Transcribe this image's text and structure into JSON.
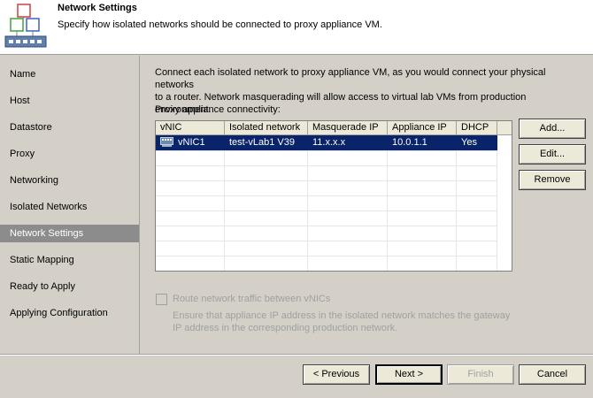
{
  "header": {
    "title": "Network Settings",
    "subtitle": "Specify how isolated networks should be connected to proxy appliance VM.",
    "logo_icon": "network-wizard-icon"
  },
  "sidebar": {
    "items": [
      {
        "label": "Name"
      },
      {
        "label": "Host"
      },
      {
        "label": "Datastore"
      },
      {
        "label": "Proxy"
      },
      {
        "label": "Networking"
      },
      {
        "label": "Isolated Networks"
      },
      {
        "label": "Network Settings",
        "active": true
      },
      {
        "label": "Static Mapping"
      },
      {
        "label": "Ready to Apply"
      },
      {
        "label": "Applying Configuration"
      }
    ]
  },
  "main": {
    "description_line1": "Connect each isolated network to proxy appliance VM, as you would connect your physical networks",
    "description_line2": "to a router. Network masquerading will allow access to virtual lab VMs from production environment.",
    "connectivity_label": "Proxy appliance connectivity:",
    "table": {
      "columns": [
        "vNIC",
        "Isolated network",
        "Masquerade IP",
        "Appliance IP",
        "DHCP"
      ],
      "rows": [
        {
          "vnic": "vNIC1",
          "isolated_network": "test-vLab1 V39",
          "masquerade_ip": "11.x.x.x",
          "appliance_ip": "10.0.1.1",
          "dhcp": "Yes",
          "selected": true
        }
      ]
    },
    "side_buttons": {
      "add": "Add...",
      "edit": "Edit...",
      "remove": "Remove"
    },
    "route_checkbox": {
      "label": "Route network traffic between vNICs",
      "checked": false,
      "enabled": false
    },
    "hint_line1": "Ensure that appliance IP address in the isolated network matches the gateway",
    "hint_line2": "IP address in the corresponding production network."
  },
  "footer": {
    "previous": "< Previous",
    "next": "Next >",
    "finish": "Finish",
    "cancel": "Cancel"
  },
  "colors": {
    "selection": "#0a246a",
    "active_nav": "#8c8c8c",
    "window_bg": "#d4d0c8"
  }
}
